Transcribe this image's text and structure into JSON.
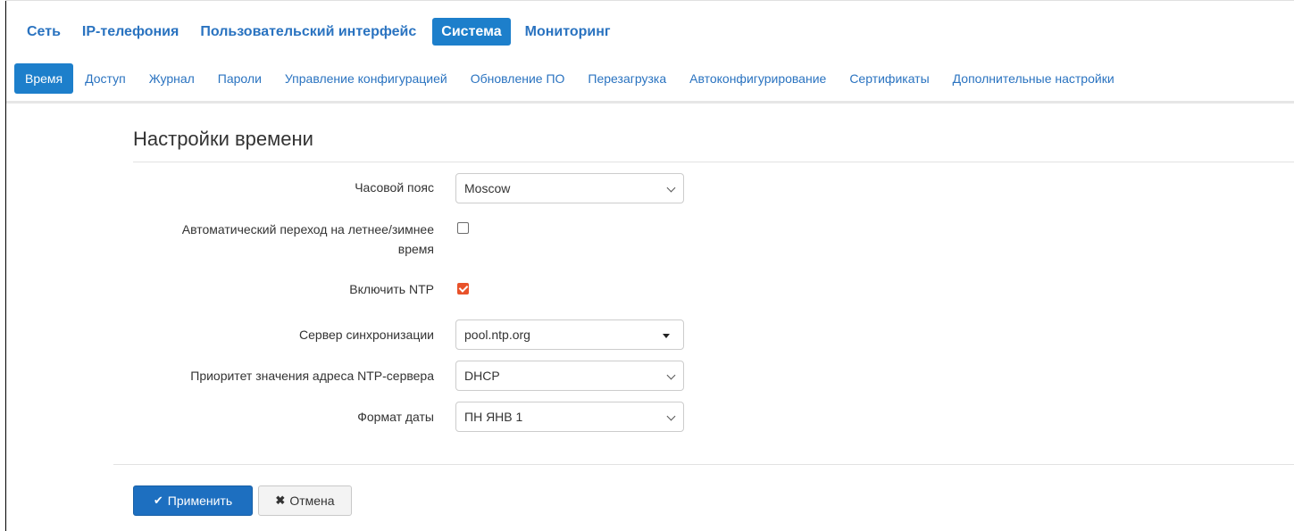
{
  "top_tabs": [
    {
      "label": "Сеть",
      "active": false
    },
    {
      "label": "IP-телефония",
      "active": false
    },
    {
      "label": "Пользовательский интерфейс",
      "active": false
    },
    {
      "label": "Система",
      "active": true
    },
    {
      "label": "Мониторинг",
      "active": false
    }
  ],
  "sub_tabs": [
    {
      "label": "Время",
      "active": true
    },
    {
      "label": "Доступ",
      "active": false
    },
    {
      "label": "Журнал",
      "active": false
    },
    {
      "label": "Пароли",
      "active": false
    },
    {
      "label": "Управление конфигурацией",
      "active": false
    },
    {
      "label": "Обновление ПО",
      "active": false
    },
    {
      "label": "Перезагрузка",
      "active": false
    },
    {
      "label": "Автоконфигурирование",
      "active": false
    },
    {
      "label": "Сертификаты",
      "active": false
    },
    {
      "label": "Дополнительные настройки",
      "active": false
    }
  ],
  "section": {
    "title": "Настройки времени"
  },
  "form": {
    "timezone": {
      "label": "Часовой пояс",
      "value": "Moscow"
    },
    "dst": {
      "label_line1": "Автоматический переход на летнее/зимнее",
      "label_line2": "время",
      "checked": false
    },
    "ntp": {
      "label": "Включить NTP",
      "checked": true
    },
    "server": {
      "label": "Сервер синхронизации",
      "value": "pool.ntp.org"
    },
    "priority": {
      "label": "Приоритет значения адреса NTP-сервера",
      "value": "DHCP"
    },
    "date_format": {
      "label": "Формат даты",
      "value": "ПН ЯНВ 1"
    }
  },
  "buttons": {
    "apply": "Применить",
    "cancel": "Отмена"
  },
  "colors": {
    "accent": "#1d7fcb",
    "link": "#2a73c0",
    "checkbox_checked": "#e8522a"
  },
  "icons": {
    "apply": "check-icon",
    "cancel": "times-icon",
    "select": "chevron-down-icon",
    "combo": "caret-down-icon"
  }
}
